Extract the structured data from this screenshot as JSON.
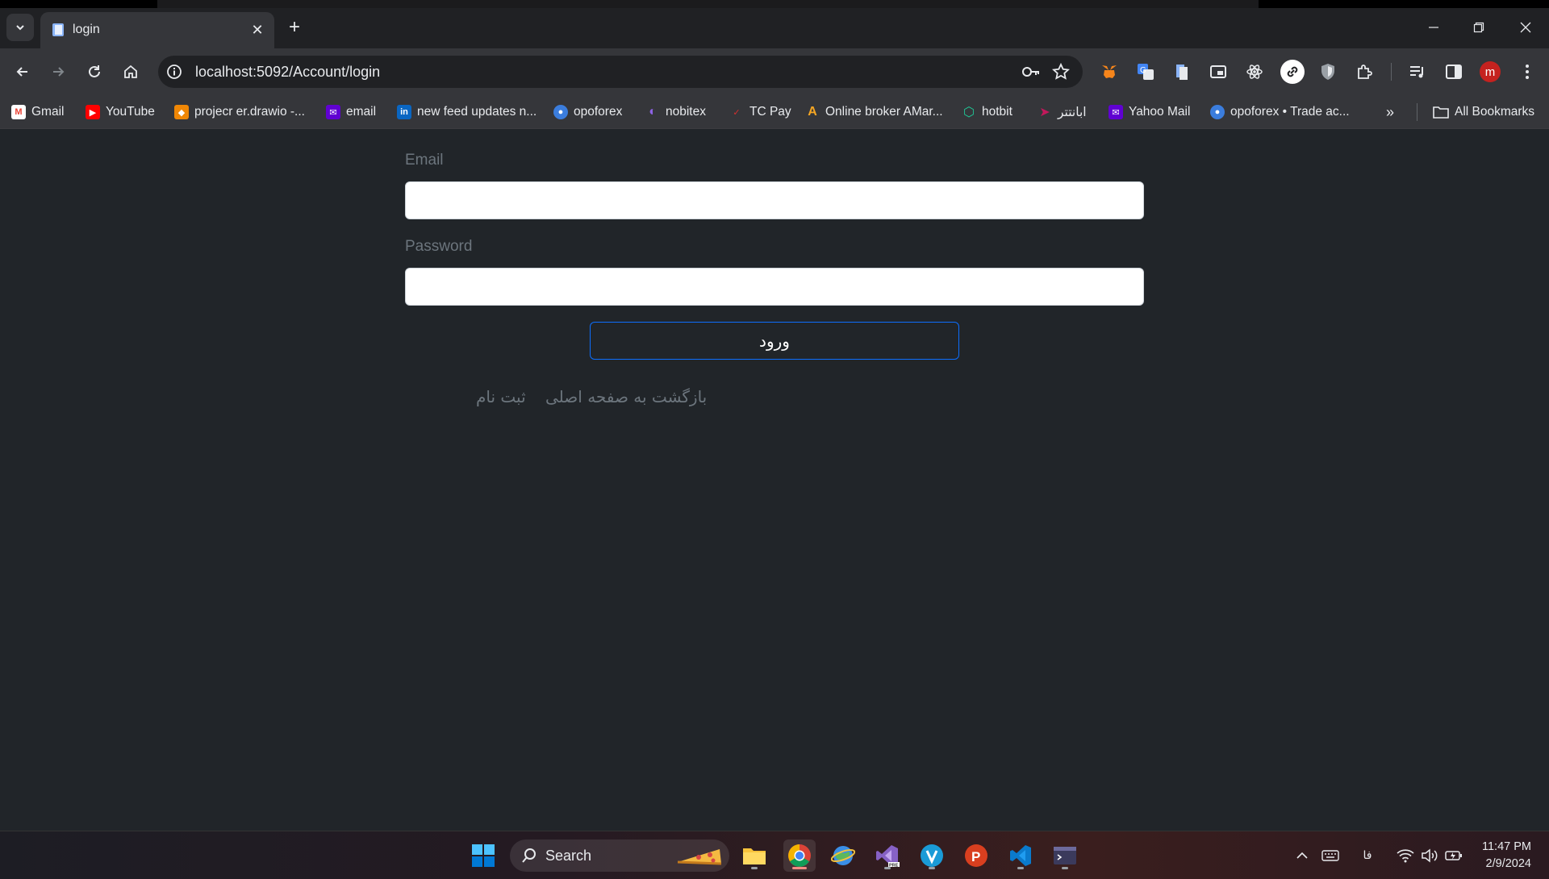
{
  "browser": {
    "tab_title": "login",
    "url": "localhost:5092/Account/login",
    "bookmarks": [
      {
        "label": "Gmail",
        "icon": "gmail-icon",
        "color": "#ea4335"
      },
      {
        "label": "YouTube",
        "icon": "youtube-icon",
        "color": "#ff0000"
      },
      {
        "label": "projecr er.drawio -...",
        "icon": "drawio-icon",
        "color": "#f08705"
      },
      {
        "label": "email",
        "icon": "yahoo-mail-icon",
        "color": "#6001d2"
      },
      {
        "label": "new feed updates n...",
        "icon": "linkedin-icon",
        "color": "#0a66c2"
      },
      {
        "label": "opoforex",
        "icon": "opoforex-icon",
        "color": "#3b7ddd"
      },
      {
        "label": "nobitex",
        "icon": "nobitex-icon",
        "color": "#6f42c1"
      },
      {
        "label": "TC Pay",
        "icon": "tcpay-icon",
        "color": "#d32f2f"
      },
      {
        "label": "Online broker AMar...",
        "icon": "amarkets-icon",
        "color": "#f5a623"
      },
      {
        "label": "hotbit",
        "icon": "hotbit-icon",
        "color": "#20c997"
      },
      {
        "label": "ابانتتر",
        "icon": "abantether-icon",
        "color": "#c2185b"
      },
      {
        "label": "Yahoo Mail",
        "icon": "yahoo-mail-icon",
        "color": "#6001d2"
      },
      {
        "label": "opoforex • Trade ac...",
        "icon": "opoforex-icon",
        "color": "#3b7ddd"
      }
    ],
    "all_bookmarks_label": "All Bookmarks",
    "profile_initial": "m"
  },
  "form": {
    "email_label": "Email",
    "email_value": "",
    "password_label": "Password",
    "password_value": "",
    "submit_label": "ورود",
    "back_home_label": "بازگشت به صفحه اصلی",
    "register_label": "ثبت نام"
  },
  "taskbar": {
    "search_label": "Search",
    "language": "فا",
    "time": "11:47 PM",
    "date": "2/9/2024"
  }
}
